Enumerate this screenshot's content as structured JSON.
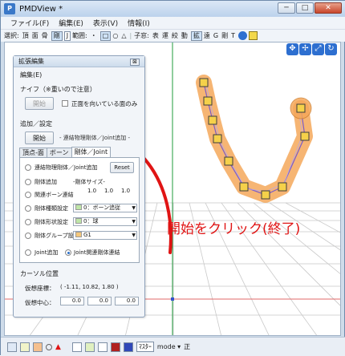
{
  "window": {
    "title": "PMDView *",
    "min_label": "─",
    "max_label": "□",
    "close_label": "✕"
  },
  "menu": [
    "ファイル(F)",
    "編集(E)",
    "表示(V)",
    "情報(I)"
  ],
  "toolbar": {
    "select_label": "選択:",
    "select_items": [
      "頂",
      "面",
      "骨",
      "剛",
      "J"
    ],
    "range_label": "範囲:",
    "range_items": [
      "・",
      "□",
      "○",
      "△"
    ],
    "subwindow_label": "子窓:",
    "subwindow_items": [
      "表",
      "運",
      "絞",
      "動",
      "拡",
      "遠",
      "G",
      "剛",
      "T"
    ]
  },
  "panel": {
    "title": "拡張編集",
    "close_label": "⊠",
    "menu": "編集(E)",
    "knife": {
      "label": "ナイフ（※重いので注意）",
      "start_button": "開始",
      "front_only_label": "正面を向いている面のみ"
    },
    "add": {
      "label": "追加／設定",
      "start_button": "開始",
      "description": "- 連結物理剛体／Joint追加 -"
    },
    "tabs": [
      "頂点-面",
      "ボーン",
      "剛体／Joint"
    ],
    "active_tab": "剛体／Joint",
    "options": {
      "linked_physics": "連結物理剛体／Joint追加",
      "reset_button": "Reset",
      "add_body": "剛体追加",
      "body_size_label": "-剛体サイズ-",
      "body_size": [
        "1.0",
        "1.0",
        "1.0"
      ],
      "related_bone": "関連ボーン連結",
      "body_type": "剛体種類設定",
      "body_type_value": "0：ボーン追従",
      "body_shape": "剛体形状設定",
      "body_shape_value": "0：球",
      "body_group": "剛体グループ設定",
      "body_group_value": "G1",
      "joint_add": "Joint追加",
      "joint_link": "Joint関連剛体連結"
    },
    "cursor": {
      "label": "カーソル位置",
      "virtual_coord_label": "仮想座標：",
      "virtual_coord_value": "( -1.11, 10.82, 1.80 )",
      "virtual_center_label": "仮想中心：",
      "virtual_center_values": [
        "0.0",
        "0.0",
        "0.0"
      ]
    }
  },
  "annotation": "開始をクリック(終了)",
  "statusbar": {
    "ma_label": "ﾏｽﾀｰ",
    "mode_label": "mode ▾",
    "right_label": "正"
  },
  "colors": {
    "annotation": "#e01414",
    "rigid_body": "#f5a85a",
    "joint": "#f5d14a",
    "selection": "#7b5cc8",
    "axis_green": "#1f9b3b",
    "axis_red": "#e06a6a"
  },
  "icons": {
    "move_gizmo": "move-icon",
    "rotate_gizmo": "rotate-icon",
    "scale_gizmo": "scale-icon"
  }
}
